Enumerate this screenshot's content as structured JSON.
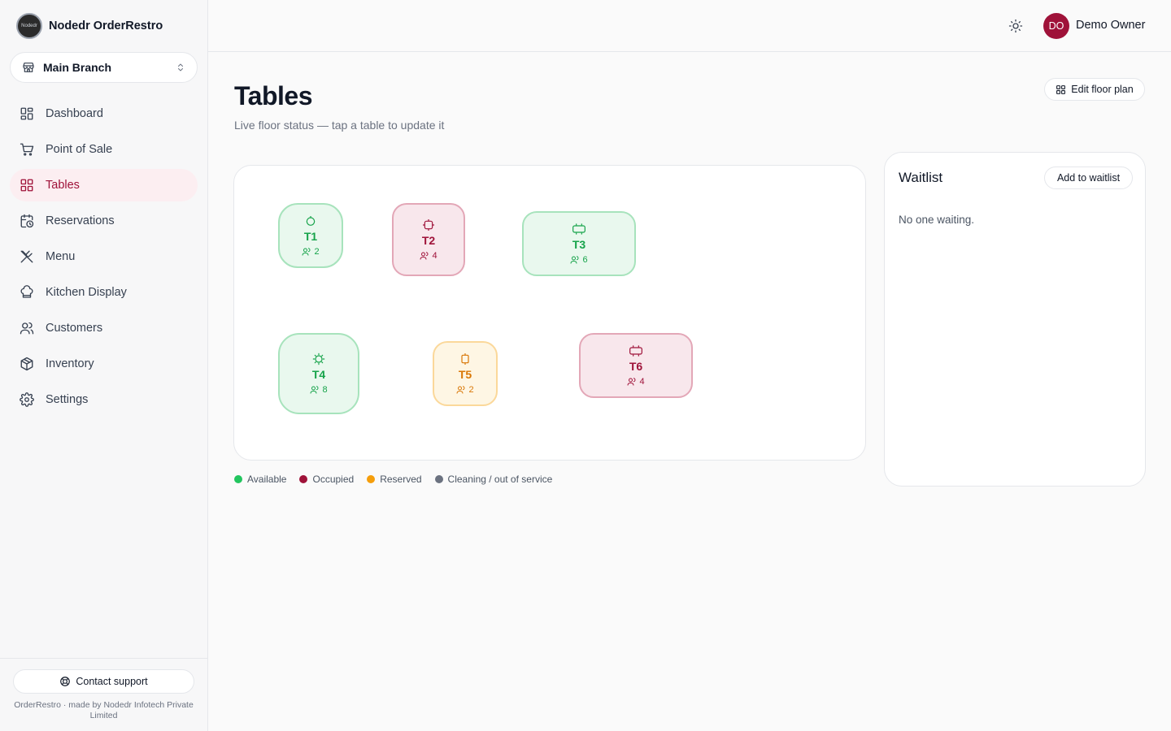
{
  "brand": {
    "name": "Nodedr OrderRestro",
    "logo_text": "Nodedr"
  },
  "branch": {
    "label": "Main Branch"
  },
  "nav": [
    {
      "key": "dashboard",
      "label": "Dashboard",
      "icon": "dashboard-icon"
    },
    {
      "key": "pos",
      "label": "Point of Sale",
      "icon": "cart-icon"
    },
    {
      "key": "tables",
      "label": "Tables",
      "icon": "grid-icon",
      "active": true
    },
    {
      "key": "reservations",
      "label": "Reservations",
      "icon": "calendar-clock-icon"
    },
    {
      "key": "menu",
      "label": "Menu",
      "icon": "utensils-icon"
    },
    {
      "key": "kitchen",
      "label": "Kitchen Display",
      "icon": "chef-hat-icon"
    },
    {
      "key": "customers",
      "label": "Customers",
      "icon": "users-icon"
    },
    {
      "key": "inventory",
      "label": "Inventory",
      "icon": "package-icon"
    },
    {
      "key": "settings",
      "label": "Settings",
      "icon": "gear-icon"
    }
  ],
  "footer": {
    "support_label": "Contact support",
    "credit": "OrderRestro · made by Nodedr Infotech Private Limited"
  },
  "header": {
    "avatar_initials": "DO",
    "user_name": "Demo Owner"
  },
  "page": {
    "title": "Tables",
    "subtitle": "Live floor status — tap a table to update it",
    "edit_label": "Edit floor plan"
  },
  "tables": [
    {
      "name": "T1",
      "seats": "2",
      "status": "available",
      "shape": "round"
    },
    {
      "name": "T2",
      "seats": "4",
      "status": "occupied",
      "shape": "square"
    },
    {
      "name": "T3",
      "seats": "6",
      "status": "available",
      "shape": "rect"
    },
    {
      "name": "T4",
      "seats": "8",
      "status": "available",
      "shape": "round"
    },
    {
      "name": "T5",
      "seats": "2",
      "status": "reserved",
      "shape": "square"
    },
    {
      "name": "T6",
      "seats": "4",
      "status": "occupied",
      "shape": "rect"
    }
  ],
  "legend": [
    {
      "label": "Available",
      "color": "#22c55e"
    },
    {
      "label": "Occupied",
      "color": "#9f1239"
    },
    {
      "label": "Reserved",
      "color": "#f59e0b"
    },
    {
      "label": "Cleaning / out of service",
      "color": "#6b7280"
    }
  ],
  "waitlist": {
    "title": "Waitlist",
    "add_label": "Add to waitlist",
    "empty_text": "No one waiting."
  }
}
